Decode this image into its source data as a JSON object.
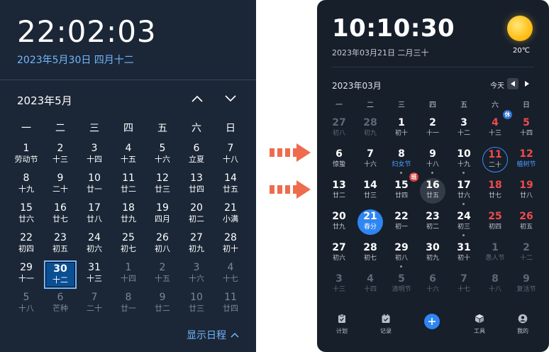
{
  "left": {
    "time": "22:02:03",
    "date": "2023年5月30日 四月十二",
    "month_label": "2023年5月",
    "weekdays": [
      "一",
      "二",
      "三",
      "四",
      "五",
      "六",
      "日"
    ],
    "days": [
      {
        "n": "1",
        "l": "劳动节"
      },
      {
        "n": "2",
        "l": "十三"
      },
      {
        "n": "3",
        "l": "十四"
      },
      {
        "n": "4",
        "l": "十五"
      },
      {
        "n": "5",
        "l": "十六"
      },
      {
        "n": "6",
        "l": "立夏"
      },
      {
        "n": "7",
        "l": "十八"
      },
      {
        "n": "8",
        "l": "十九"
      },
      {
        "n": "9",
        "l": "二十"
      },
      {
        "n": "10",
        "l": "廿一"
      },
      {
        "n": "11",
        "l": "廿二"
      },
      {
        "n": "12",
        "l": "廿三"
      },
      {
        "n": "13",
        "l": "廿四"
      },
      {
        "n": "14",
        "l": "廿五"
      },
      {
        "n": "15",
        "l": "廿六"
      },
      {
        "n": "16",
        "l": "廿七"
      },
      {
        "n": "17",
        "l": "廿八"
      },
      {
        "n": "18",
        "l": "廿九"
      },
      {
        "n": "19",
        "l": "四月"
      },
      {
        "n": "20",
        "l": "初二"
      },
      {
        "n": "21",
        "l": "小满"
      },
      {
        "n": "22",
        "l": "初四"
      },
      {
        "n": "23",
        "l": "初五"
      },
      {
        "n": "24",
        "l": "初六"
      },
      {
        "n": "25",
        "l": "初七"
      },
      {
        "n": "26",
        "l": "初八"
      },
      {
        "n": "27",
        "l": "初九"
      },
      {
        "n": "28",
        "l": "初十"
      },
      {
        "n": "29",
        "l": "十一"
      },
      {
        "n": "30",
        "l": "十二",
        "today": true
      },
      {
        "n": "31",
        "l": "十三"
      },
      {
        "n": "1",
        "l": "十四",
        "dim": true
      },
      {
        "n": "2",
        "l": "十五",
        "dim": true
      },
      {
        "n": "3",
        "l": "十六",
        "dim": true
      },
      {
        "n": "4",
        "l": "十七",
        "dim": true
      },
      {
        "n": "5",
        "l": "十八",
        "dim": true
      },
      {
        "n": "6",
        "l": "芒种",
        "dim": true
      },
      {
        "n": "7",
        "l": "二十",
        "dim": true
      },
      {
        "n": "8",
        "l": "廿一",
        "dim": true
      },
      {
        "n": "9",
        "l": "廿二",
        "dim": true
      },
      {
        "n": "10",
        "l": "廿三",
        "dim": true
      },
      {
        "n": "11",
        "l": "廿四",
        "dim": true
      }
    ],
    "show_schedule": "显示日程"
  },
  "right": {
    "time": "10:10:30",
    "date": "2023年03月21日 二月三十",
    "temperature": "20℃",
    "month_label": "2023年03月",
    "today_button": "今天",
    "weekdays": [
      "一",
      "二",
      "三",
      "四",
      "五",
      "六",
      "日"
    ],
    "days": [
      {
        "n": "27",
        "l": "初八",
        "dim": true
      },
      {
        "n": "28",
        "l": "初九",
        "dim": true
      },
      {
        "n": "1",
        "l": "初十"
      },
      {
        "n": "2",
        "l": "十一"
      },
      {
        "n": "3",
        "l": "十二"
      },
      {
        "n": "4",
        "l": "十三",
        "red": true,
        "badge": "休"
      },
      {
        "n": "5",
        "l": "十四",
        "red": true
      },
      {
        "n": "6",
        "l": "惊蛰"
      },
      {
        "n": "7",
        "l": "十六"
      },
      {
        "n": "8",
        "l": "妇女节",
        "fest": true,
        "dot": true
      },
      {
        "n": "9",
        "l": "十八",
        "dot": true
      },
      {
        "n": "10",
        "l": "十九",
        "dot": true
      },
      {
        "n": "11",
        "l": "二十",
        "red": true,
        "sel": true
      },
      {
        "n": "12",
        "l": "植树节",
        "red": true,
        "fest": true
      },
      {
        "n": "13",
        "l": "廿二"
      },
      {
        "n": "14",
        "l": "廿三"
      },
      {
        "n": "15",
        "l": "廿四",
        "badge": "班"
      },
      {
        "n": "16",
        "l": "廿五",
        "hov": true
      },
      {
        "n": "17",
        "l": "廿六",
        "dot": true
      },
      {
        "n": "18",
        "l": "廿七",
        "red": true
      },
      {
        "n": "19",
        "l": "廿八",
        "red": true
      },
      {
        "n": "20",
        "l": "廿九"
      },
      {
        "n": "21",
        "l": "春分",
        "tod": true
      },
      {
        "n": "22",
        "l": "初一"
      },
      {
        "n": "23",
        "l": "初二"
      },
      {
        "n": "24",
        "l": "初三",
        "dot": true
      },
      {
        "n": "25",
        "l": "初四",
        "red": true
      },
      {
        "n": "26",
        "l": "初五",
        "red": true
      },
      {
        "n": "27",
        "l": "初六"
      },
      {
        "n": "28",
        "l": "初七"
      },
      {
        "n": "29",
        "l": "初八",
        "dot": true
      },
      {
        "n": "30",
        "l": "初九"
      },
      {
        "n": "31",
        "l": "初十"
      },
      {
        "n": "1",
        "l": "愚人节",
        "dim": true
      },
      {
        "n": "2",
        "l": "十二",
        "dim": true
      },
      {
        "n": "3",
        "l": "十三",
        "dim": true
      },
      {
        "n": "4",
        "l": "十四",
        "dim": true
      },
      {
        "n": "5",
        "l": "清明节",
        "dim": true
      },
      {
        "n": "6",
        "l": "十六",
        "dim": true
      },
      {
        "n": "7",
        "l": "十七",
        "dim": true
      },
      {
        "n": "8",
        "l": "十八",
        "dim": true
      },
      {
        "n": "9",
        "l": "复活节",
        "dim": true
      }
    ],
    "tabs": [
      {
        "label": "计划",
        "icon": "clipboard-icon"
      },
      {
        "label": "记录",
        "icon": "calendar-check-icon"
      },
      {
        "label": "工具",
        "icon": "cube-icon"
      },
      {
        "label": "我的",
        "icon": "user-icon"
      }
    ],
    "colors": {
      "accent": "#2f86f3",
      "weekend": "#ef4b4b",
      "festival": "#4d9dff"
    }
  },
  "arrow_color": "#ee6b4d"
}
